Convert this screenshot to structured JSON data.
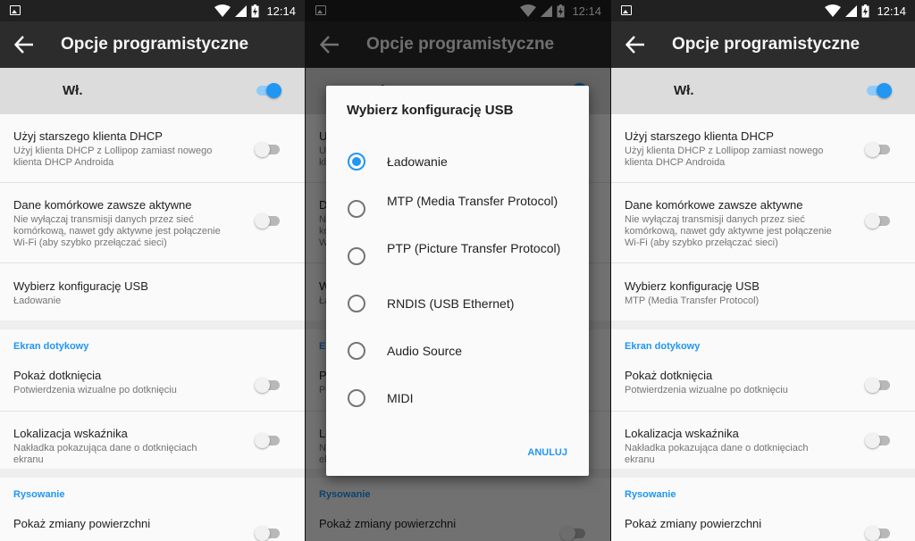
{
  "status_bar": {
    "time": "12:14"
  },
  "app_bar": {
    "title": "Opcje programistyczne"
  },
  "master_switch": {
    "label": "Wł.",
    "on": true
  },
  "settings": {
    "dhcp": {
      "title": "Użyj starszego klienta DHCP",
      "subtitle": "Użyj klienta DHCP z Lollipop zamiast nowego klienta DHCP Androida",
      "on": false
    },
    "mobile_data": {
      "title": "Dane komórkowe zawsze aktywne",
      "subtitle": "Nie wyłączaj transmisji danych przez sieć komórkową, nawet gdy aktywne jest połączenie Wi-Fi (aby szybko przełączać sieci)",
      "on": false
    },
    "usb_config": {
      "title": "Wybierz konfigurację USB",
      "value_before": "Ładowanie",
      "value_after": "MTP (Media Transfer Protocol)"
    },
    "touch_category": "Ekran dotykowy",
    "show_taps": {
      "title": "Pokaż dotknięcia",
      "subtitle": "Potwierdzenia wizualne po dotknięciu",
      "on": false
    },
    "pointer_location": {
      "title": "Lokalizacja wskaźnika",
      "subtitle": "Nakładka pokazująca dane o dotknięciach ekranu",
      "on": false
    },
    "drawing_category": "Rysowanie",
    "surface_updates": {
      "title": "Pokaż zmiany powierzchni"
    }
  },
  "usb_dialog": {
    "title": "Wybierz konfigurację USB",
    "selected_index": 0,
    "options": [
      "Ładowanie",
      "MTP (Media Transfer Protocol)",
      "PTP (Picture Transfer Protocol)",
      "RNDIS (USB Ethernet)",
      "Audio Source",
      "MIDI"
    ],
    "cancel_label": "ANULUJ"
  },
  "colors": {
    "accent": "#2196f3",
    "app_bar": "#2c2c2c",
    "status_bar": "#212121"
  }
}
